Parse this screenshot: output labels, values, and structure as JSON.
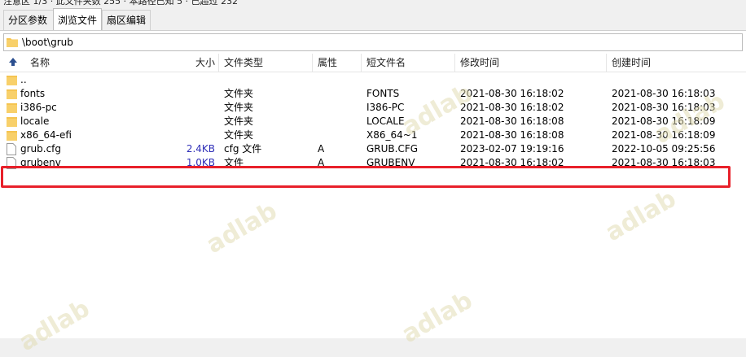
{
  "top_status": "注意区 1/3 · 此文件夹数 255 · 本路径已知 5 · 已超过 232",
  "tabs": [
    {
      "label": "分区参数"
    },
    {
      "label": "浏览文件"
    },
    {
      "label": "扇区编辑"
    }
  ],
  "path": "\\boot\\grub",
  "columns": {
    "name": "名称",
    "size": "大小",
    "type": "文件类型",
    "attr": "属性",
    "short": "短文件名",
    "modified": "修改时间",
    "created": "创建时间"
  },
  "rows": [
    {
      "name": "..",
      "size": "",
      "type": "",
      "attr": "",
      "short": "",
      "modified": "",
      "created": "",
      "icon": "folder-icon"
    },
    {
      "name": "fonts",
      "size": "",
      "type": "文件夹",
      "attr": "",
      "short": "FONTS",
      "modified": "2021-08-30 16:18:02",
      "created": "2021-08-30 16:18:03",
      "icon": "folder-icon"
    },
    {
      "name": "i386-pc",
      "size": "",
      "type": "文件夹",
      "attr": "",
      "short": "I386-PC",
      "modified": "2021-08-30 16:18:02",
      "created": "2021-08-30 16:18:03",
      "icon": "folder-icon"
    },
    {
      "name": "locale",
      "size": "",
      "type": "文件夹",
      "attr": "",
      "short": "LOCALE",
      "modified": "2021-08-30 16:18:08",
      "created": "2021-08-30 16:18:09",
      "icon": "folder-icon"
    },
    {
      "name": "x86_64-efi",
      "size": "",
      "type": "文件夹",
      "attr": "",
      "short": "X86_64~1",
      "modified": "2021-08-30 16:18:08",
      "created": "2021-08-30 16:18:09",
      "icon": "folder-icon"
    },
    {
      "name": "grub.cfg",
      "size": "2.4KB",
      "type": "cfg 文件",
      "attr": "A",
      "short": "GRUB.CFG",
      "modified": "2023-02-07 19:19:16",
      "created": "2022-10-05 09:25:56",
      "icon": "file-icon"
    },
    {
      "name": "grubenv",
      "size": "1.0KB",
      "type": "文件",
      "attr": "A",
      "short": "GRUBENV",
      "modified": "2021-08-30 16:18:02",
      "created": "2021-08-30 16:18:03",
      "icon": "file-icon"
    }
  ],
  "watermark": "adlab",
  "colors": {
    "highlight": "#e8202a",
    "size_text": "#3030b8",
    "folder": "#f5c451",
    "watermark": "#e1dcb4"
  }
}
